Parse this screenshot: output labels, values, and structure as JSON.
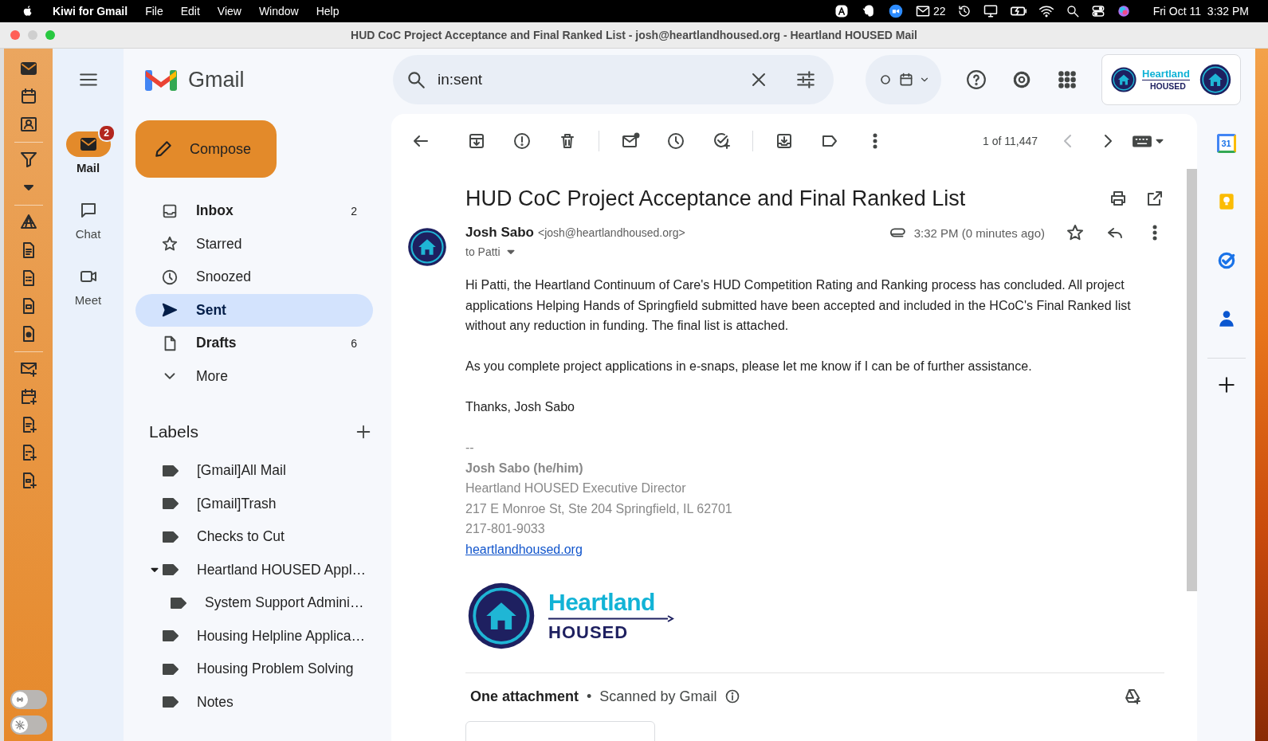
{
  "menu_bar": {
    "app_name": "Kiwi for Gmail",
    "menus": [
      "File",
      "Edit",
      "View",
      "Window",
      "Help"
    ],
    "mail_count": "22",
    "clock": "Fri Oct 11  3:32 PM"
  },
  "window": {
    "title": "HUD CoC Project Acceptance and Final Ranked List - josh@heartlandhoused.org - Heartland HOUSED Mail"
  },
  "toolbar_toggles": [
    {
      "on": false
    },
    {
      "on": false
    }
  ],
  "rail": [
    {
      "kind": "mail",
      "label": "Mail",
      "selected": true,
      "badge": "2"
    },
    {
      "kind": "chat",
      "label": "Chat",
      "selected": false
    },
    {
      "kind": "meet",
      "label": "Meet",
      "selected": false
    }
  ],
  "brand": "Gmail",
  "compose": "Compose",
  "folders": [
    {
      "kind": "inbox",
      "label": "Inbox",
      "count": "2",
      "unread": true,
      "selected": false
    },
    {
      "kind": "starred",
      "label": "Starred",
      "unread": false,
      "selected": false
    },
    {
      "kind": "snoozed",
      "label": "Snoozed",
      "unread": false,
      "selected": false
    },
    {
      "kind": "sent",
      "label": "Sent",
      "unread": false,
      "selected": true
    },
    {
      "kind": "drafts",
      "label": "Drafts",
      "count": "6",
      "unread": true,
      "selected": false
    },
    {
      "kind": "more",
      "label": "More",
      "unread": false,
      "selected": false
    }
  ],
  "labels": {
    "title": "Labels",
    "items": [
      {
        "label": "[Gmail]All Mail"
      },
      {
        "label": "[Gmail]Trash"
      },
      {
        "label": "Checks to Cut"
      },
      {
        "label": "Heartland HOUSED Appl…",
        "expanded": true,
        "children": [
          {
            "label": "System Support Admini…"
          }
        ]
      },
      {
        "label": "Housing Helpline Applica…"
      },
      {
        "label": "Housing Problem Solving"
      },
      {
        "label": "Notes"
      }
    ]
  },
  "search": {
    "value": "in:sent"
  },
  "account": {
    "logo_top": "Heartland",
    "logo_bottom": "HOUSED"
  },
  "pager": "1 of 11,447",
  "email": {
    "subject": "HUD CoC Project Acceptance and Final Ranked List",
    "sender": "Josh Sabo",
    "address": "<josh@heartlandhoused.org>",
    "recipient": "to Patti",
    "time": "3:32 PM (0 minutes ago)",
    "starred": false,
    "body": [
      "Hi Patti, the Heartland Continuum of Care's HUD Competition Rating and Ranking process has concluded. All project applications Helping Hands of Springfield submitted have been accepted and included in the HCoC's Final Ranked list without any reduction in funding. The final list is attached.",
      "As you complete project applications in e-snaps, please let me know if I can be of further assistance.",
      "Thanks, Josh Sabo"
    ],
    "signature": {
      "separator": "--",
      "name": "Josh Sabo (he/him)",
      "lines": [
        "Heartland HOUSED Executive Director",
        "217 E Monroe St, Ste 204 Springfield, IL 62701",
        "217-801-9033"
      ],
      "link": "heartlandhoused.org",
      "logo_top": "Heartland",
      "logo_bottom": "HOUSED"
    }
  },
  "attachments": {
    "title": "One attachment",
    "separator": "•",
    "note": "Scanned by Gmail"
  },
  "side_panel": {
    "calendar_day": "31"
  }
}
